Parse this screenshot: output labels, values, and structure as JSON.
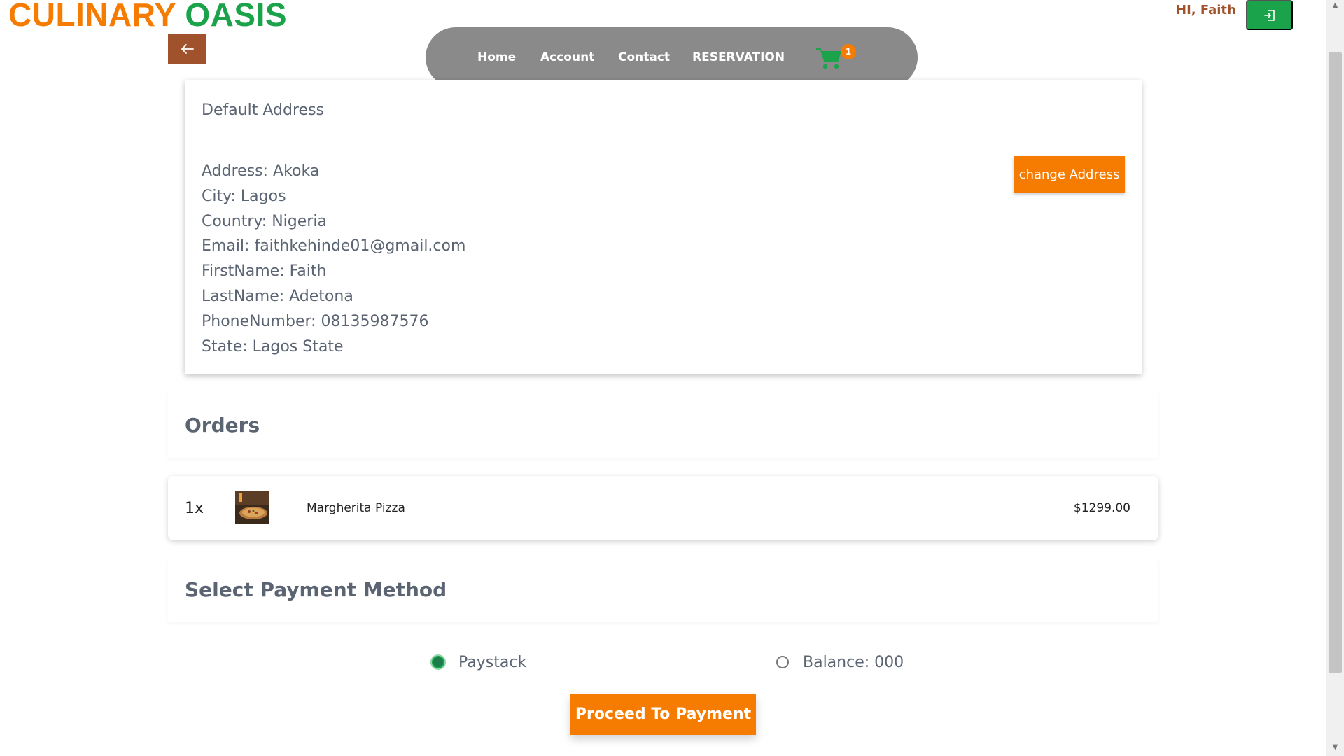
{
  "brand": {
    "part1": "CULINARY",
    "part2": "OASIS",
    "color1": "#f57c00",
    "color2": "#1aa34a"
  },
  "header": {
    "back_icon": "arrow-left-icon",
    "nav": {
      "home": "Home",
      "account": "Account",
      "contact": "Contact",
      "reservation": "RESERVATION",
      "cart_icon": "shopping-cart-icon",
      "cart_count": "1"
    },
    "greeting": "HI, Faith",
    "logout_icon": "sign-out-icon"
  },
  "address": {
    "title": "Default Address",
    "lines": [
      "Address: Akoka",
      "City: Lagos",
      "Country: Nigeria",
      "Email: faithkehinde01@gmail.com",
      "FirstName: Faith",
      "LastName: Adetona",
      "PhoneNumber: 08135987576",
      "State: Lagos State"
    ],
    "change_button": "change Address"
  },
  "orders": {
    "title": "Orders",
    "items": [
      {
        "qty": "1x",
        "name": "Margherita Pizza",
        "price": "$1299.00"
      }
    ]
  },
  "payment": {
    "title": "Select Payment Method",
    "options": [
      {
        "label": "Paystack",
        "selected": true
      },
      {
        "label": "Balance: 000",
        "selected": false
      }
    ],
    "proceed_button": "Proceed To Payment"
  },
  "colors": {
    "accent": "#f57c00",
    "success": "#1aa34a",
    "brown": "#a0522d",
    "nav_bg": "#8a8a8a"
  }
}
